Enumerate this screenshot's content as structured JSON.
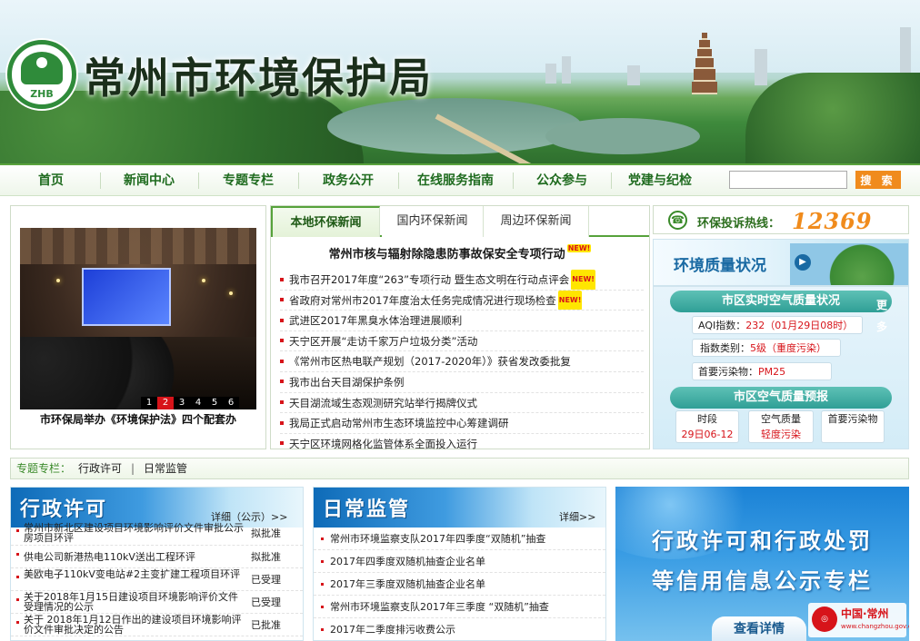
{
  "site": {
    "title": "常州市环境保护局",
    "logo_text": "ZHB"
  },
  "nav": {
    "items": [
      {
        "label": "首页"
      },
      {
        "label": "新闻中心"
      },
      {
        "label": "专题专栏"
      },
      {
        "label": "政务公开"
      },
      {
        "label": "在线服务指南"
      },
      {
        "label": "公众参与"
      },
      {
        "label": "党建与纪检"
      }
    ],
    "search_placeholder": "",
    "search_button": "搜 索"
  },
  "slideshow": {
    "pages": [
      "1",
      "2",
      "3",
      "4",
      "5",
      "6"
    ],
    "active_page": "2",
    "caption": "市环保局举办《环境保护法》四个配套办"
  },
  "news": {
    "tabs": [
      "本地环保新闻",
      "国内环保新闻",
      "周边环保新闻"
    ],
    "active_tab": "本地环保新闻",
    "headline": "常州市核与辐射除隐患防事故保安全专项行动",
    "new_badge": "NEW!",
    "items": [
      {
        "text": "我市召开2017年度“263”专项行动 暨生态文明在行动点评会",
        "new": true
      },
      {
        "text": "省政府对常州市2017年度治太任务完成情况进行现场检查",
        "new": true
      },
      {
        "text": "武进区2017年黑臭水体治理进展顺利",
        "new": false
      },
      {
        "text": "天宁区开展“走访千家万户垃圾分类”活动",
        "new": false
      },
      {
        "text": "《常州市区热电联产规划（2017-2020年）》获省发改委批复",
        "new": false
      },
      {
        "text": "我市出台天目湖保护条例",
        "new": false
      },
      {
        "text": "天目湖流域生态观测研究站举行揭牌仪式",
        "new": false
      },
      {
        "text": "我局正式启动常州市生态环境监控中心筹建调研",
        "new": false
      },
      {
        "text": "天宁区环境网格化监管体系全面投入运行",
        "new": false
      }
    ]
  },
  "hotline": {
    "label": "环保投诉热线：",
    "number": "12369",
    "icon": "phone-icon"
  },
  "env_quality": {
    "title": "环境质量状况"
  },
  "air_quality": {
    "realtime_title": "市区实时空气质量状况",
    "more": "更多",
    "aqi_label": "AQI指数：",
    "aqi_value": "232（01月29日08时）",
    "category_label": "指数类别：",
    "category_value": "5级（重度污染）",
    "pollutant_label": "首要污染物：",
    "pollutant_value": "PM25",
    "forecast_title": "市区空气质量预报",
    "forecast": {
      "time_label": "时段",
      "time_value": "29日06-12",
      "quality_label": "空气质量",
      "quality_value": "轻度污染",
      "pollutant_label": "首要污染物",
      "pollutant_value": ""
    }
  },
  "special": {
    "label": "专题专栏：",
    "items": [
      "行政许可",
      "日常监管"
    ],
    "separator": "|"
  },
  "permit": {
    "title": "行政许可",
    "more": "详细（公示）>>",
    "items": [
      {
        "title": "常州市新北区建设项目环境影响评价文件审批公示房项目环评",
        "status": "拟批准"
      },
      {
        "title": "供电公司新港热电110kV送出工程环评",
        "status": "拟批准"
      },
      {
        "title": "美欧电子110kV变电站#2主变扩建工程项目环评",
        "status": "已受理"
      },
      {
        "title": "关于2018年1月15日建设项目环境影响评价文件受理情况的公示",
        "status": "已受理"
      },
      {
        "title": "关于 2018年1月12日作出的建设项目环境影响评价文件审批决定的公告",
        "status": "已批准"
      }
    ]
  },
  "monitor": {
    "title": "日常监管",
    "more": "详细>>",
    "items": [
      "常州市环境监察支队2017年四季度“双随机”抽查",
      "2017年四季度双随机抽查企业名单",
      "2017年三季度双随机抽查企业名单",
      "常州市环境监察支队2017年三季度 “双随机”抽查",
      "2017年二季度排污收费公示"
    ]
  },
  "credit": {
    "line1": "行政许可和行政处罚",
    "line2": "等信用信息公示专栏",
    "button": "查看详情",
    "badge_title": "中国·常州",
    "badge_url": "www.changzhou.gov.cn"
  },
  "colors": {
    "brand_green": "#2f8b3a",
    "accent_orange": "#f08b1c",
    "link_blue": "#1a6aa3",
    "alert_red": "#d7141a"
  }
}
